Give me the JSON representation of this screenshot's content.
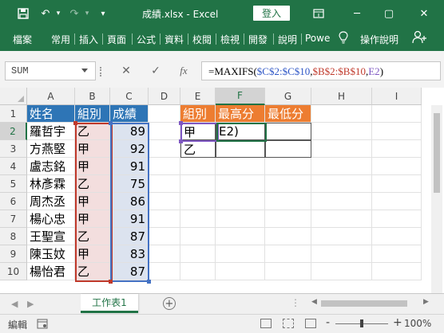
{
  "window": {
    "title": "成績.xlsx  -  Excel",
    "login_label": "登入",
    "minimize": "─",
    "restore": "▢",
    "close": "✕",
    "save": "💾",
    "undo": "↶",
    "redo": "↷",
    "customize": "▾"
  },
  "ribbon": {
    "tabs": [
      "檔案",
      "常用",
      "插入",
      "頁面",
      "公式",
      "資料",
      "校閱",
      "檢視",
      "開發",
      "說明",
      "Powe"
    ],
    "help_label": "操作說明",
    "share_label": "Ω",
    "tip_icon": "lightbulb-icon"
  },
  "formula_bar": {
    "name_box": "SUM",
    "cancel": "✕",
    "enter": "✓",
    "fx": "fx",
    "formula_parts": [
      {
        "text": "=MAXIFS(",
        "color": "base"
      },
      {
        "text": "$C$2:$C$10",
        "color": "blue"
      },
      {
        "text": ",",
        "color": "base"
      },
      {
        "text": "$B$2:$B$10",
        "color": "red"
      },
      {
        "text": ",",
        "color": "base"
      },
      {
        "text": "E2",
        "color": "purple"
      },
      {
        "text": ")",
        "color": "base"
      }
    ]
  },
  "sheet": {
    "columns": [
      "A",
      "B",
      "C",
      "D",
      "E",
      "F",
      "G",
      "H",
      "I"
    ],
    "rows": [
      "1",
      "2",
      "3",
      "4",
      "5",
      "6",
      "7",
      "8",
      "9",
      "10"
    ],
    "header": [
      "姓名",
      "組別",
      "成績"
    ],
    "data": [
      [
        "羅哲宇",
        "乙",
        "89"
      ],
      [
        "方燕堅",
        "甲",
        "92"
      ],
      [
        "盧志銘",
        "甲",
        "91"
      ],
      [
        "林彥霖",
        "乙",
        "75"
      ],
      [
        "周杰丞",
        "甲",
        "86"
      ],
      [
        "楊心忠",
        "甲",
        "91"
      ],
      [
        "王聖宣",
        "乙",
        "87"
      ],
      [
        "陳玉妏",
        "甲",
        "83"
      ],
      [
        "楊怡君",
        "乙",
        "87"
      ]
    ],
    "summary_header": [
      "組別",
      "最高分",
      "最低分"
    ],
    "summary_rows": [
      [
        "甲",
        "E2)",
        ""
      ],
      [
        "乙",
        "",
        ""
      ]
    ]
  },
  "sheet_tabs": {
    "active": "工作表1",
    "add": "+",
    "prev": "◀",
    "next": "▶"
  },
  "status": {
    "mode": "編輯",
    "zoom": "100%",
    "zoom_minus": "-",
    "zoom_plus": "+"
  },
  "colors": {
    "excel_green": "#217346",
    "header_blue": "#2e75b6",
    "header_orange": "#ed7d31"
  }
}
